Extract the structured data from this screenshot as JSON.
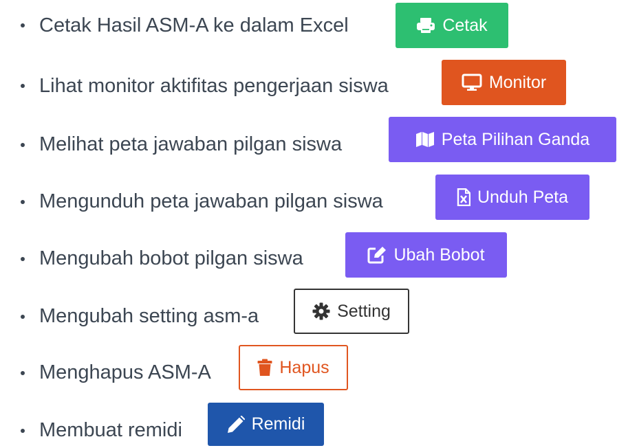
{
  "items": [
    {
      "text": "Cetak Hasil ASM-A ke dalam Excel",
      "button": "Cetak",
      "icon": "print-icon",
      "color": "#2dbf71"
    },
    {
      "text": "Lihat monitor aktifitas pengerjaan siswa",
      "button": "Monitor",
      "icon": "desktop-icon",
      "color": "#e0551f"
    },
    {
      "text": "Melihat peta jawaban pilgan siswa",
      "button": "Peta Pilihan Ganda",
      "icon": "map-icon",
      "color": "#7a5cf2"
    },
    {
      "text": "Mengunduh peta jawaban pilgan siswa",
      "button": "Unduh Peta",
      "icon": "file-excel-icon",
      "color": "#7a5cf2"
    },
    {
      "text": "Mengubah bobot pilgan siswa",
      "button": "Ubah Bobot",
      "icon": "edit-icon",
      "color": "#7a5cf2"
    },
    {
      "text": "Mengubah setting asm-a",
      "button": "Setting",
      "icon": "gear-icon",
      "color": "#333333"
    },
    {
      "text": "Menghapus ASM-A",
      "button": "Hapus",
      "icon": "trash-icon",
      "color": "#e0551f"
    },
    {
      "text": "Membuat remidi",
      "button": "Remidi",
      "icon": "pencil-icon",
      "color": "#1f56ab"
    }
  ]
}
